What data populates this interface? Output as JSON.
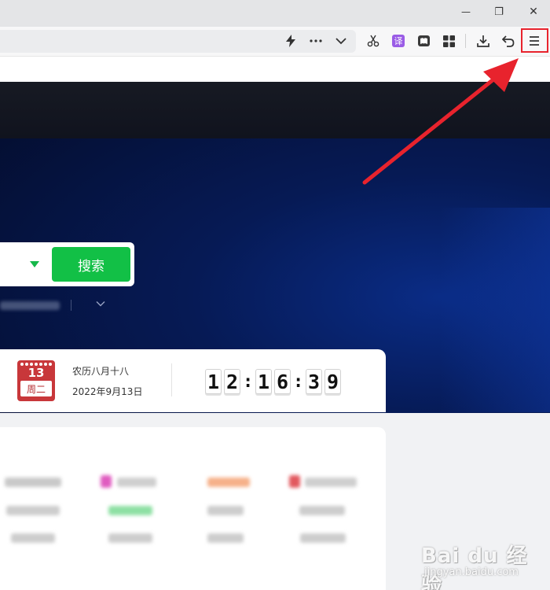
{
  "window": {
    "minimize_glyph": "—",
    "restore_glyph": "❐",
    "close_glyph": "✕"
  },
  "toolbar": {
    "icons": [
      "lightning-icon",
      "more-icon",
      "chevron-down-icon",
      "scissors-icon",
      "translate-icon",
      "reader-icon",
      "apps-grid-icon",
      "download-icon",
      "undo-icon",
      "menu-icon"
    ],
    "translate_glyph": "译"
  },
  "search": {
    "button_label": "搜索"
  },
  "calendar": {
    "day_number": "13",
    "weekday": "周二",
    "lunar_date": "农历八月十八",
    "date": "2022年9月13日"
  },
  "clock": {
    "h1": "1",
    "h2": "2",
    "m1": "1",
    "m2": "6",
    "s1": "3",
    "s2": "9",
    "sep": ":"
  },
  "watermark": {
    "text": "Bai du 经验",
    "url": "jingyan.baidu.com"
  },
  "colors": {
    "accent_green": "#12c046",
    "annotation_red": "#e8232d",
    "calendar_red": "#c8373a"
  }
}
